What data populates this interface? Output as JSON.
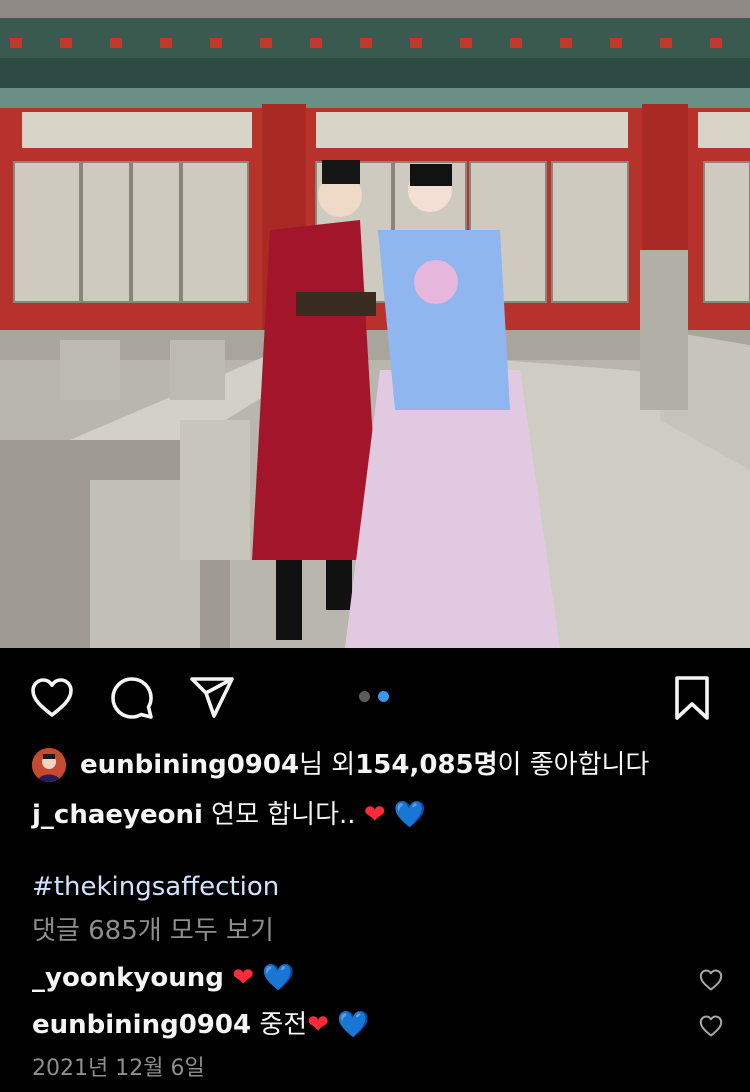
{
  "post": {
    "photo_icon": "photo-image",
    "carousel_total": 2,
    "carousel_active": 2
  },
  "actions": {
    "like_icon": "heart-icon",
    "comment_icon": "comment-bubble-icon",
    "share_icon": "send-paper-plane-icon",
    "save_icon": "bookmark-icon"
  },
  "likes": {
    "first_user": "eunbining0904",
    "suffix_1": "님 외 ",
    "count": "154,085명",
    "suffix_2": "이 좋아합니다"
  },
  "caption": {
    "username": "j_chaeyeoni",
    "text": " 연모 합니다..",
    "emoji_1": "❤",
    "emoji_2": "💙",
    "hashtag": "#thekingsaffection"
  },
  "view_all_comments": "댓글 685개 모두 보기",
  "comments": [
    {
      "username": "_yoonkyoung",
      "text": "",
      "emoji_1": "❤",
      "emoji_2": "💙"
    },
    {
      "username": "eunbining0904",
      "text": " 중전",
      "emoji_1": "❤",
      "emoji_2": "💙"
    }
  ],
  "date": "2021년 12월 6일",
  "colors": {
    "background": "#000000",
    "text": "#f5f5f5",
    "muted": "#8e8e8e",
    "carousel_active": "#3897f0",
    "carousel_inactive": "#5b5b5b"
  }
}
